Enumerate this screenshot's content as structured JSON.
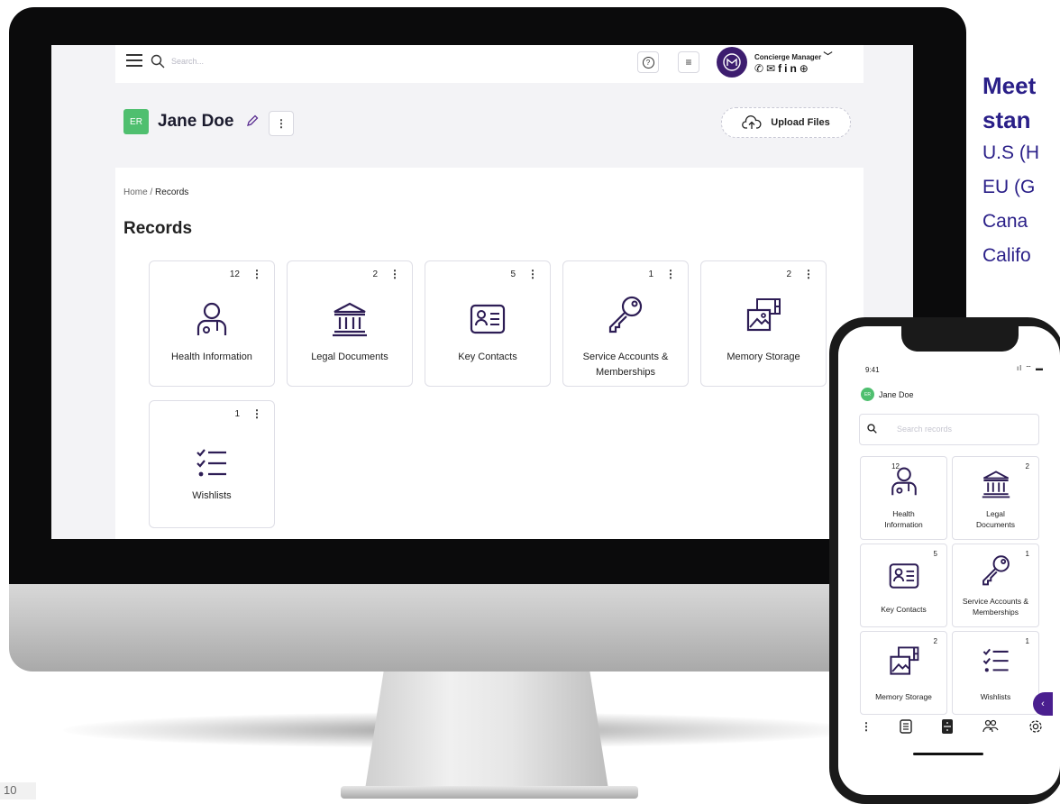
{
  "desktop": {
    "search_placeholder": "Search...",
    "manager_label": "Concierge Manager",
    "user_initials": "ER",
    "user_name": "Jane Doe",
    "upload_label": "Upload Files",
    "breadcrumb_home": "Home",
    "breadcrumb_sep": " / ",
    "breadcrumb_current": "Records",
    "page_title": "Records",
    "cards": [
      {
        "label": "Health Information",
        "count": "12",
        "icon": "person-icon"
      },
      {
        "label": "Legal Documents",
        "count": "2",
        "icon": "bank-icon"
      },
      {
        "label": "Key Contacts",
        "count": "5",
        "icon": "contact-card-icon"
      },
      {
        "label": "Service Accounts & Memberships",
        "count": "1",
        "icon": "key-icon"
      },
      {
        "label": "Memory Storage",
        "count": "2",
        "icon": "photo-stack-icon"
      },
      {
        "label": "Wishlists",
        "count": "1",
        "icon": "checklist-icon"
      }
    ]
  },
  "marketing": {
    "headline_1": "Meet",
    "headline_2": "stan",
    "laws": [
      "U.S (H",
      "EU (G",
      "Cana",
      "Califo"
    ]
  },
  "phone": {
    "time": "9:41",
    "user_initials": "ER",
    "user_name": "Jane Doe",
    "search_placeholder": "Search records",
    "cards": [
      {
        "label": "Health Information",
        "count": "12"
      },
      {
        "label": "Legal Documents",
        "count": "2"
      },
      {
        "label": "Key Contacts",
        "count": "5"
      },
      {
        "label": "Service Accounts & Memberships",
        "count": "1"
      },
      {
        "label": "Memory Storage",
        "count": "2"
      },
      {
        "label": "Wishlists",
        "count": "1"
      }
    ],
    "tabs": [
      "more-icon",
      "records-icon",
      "storage-icon",
      "contacts-icon",
      "settings-icon"
    ]
  },
  "page_number": "10",
  "colors": {
    "accent": "#3d1d6f",
    "brand_text": "#2a1f88",
    "avatar_green": "#4fbf6f"
  }
}
